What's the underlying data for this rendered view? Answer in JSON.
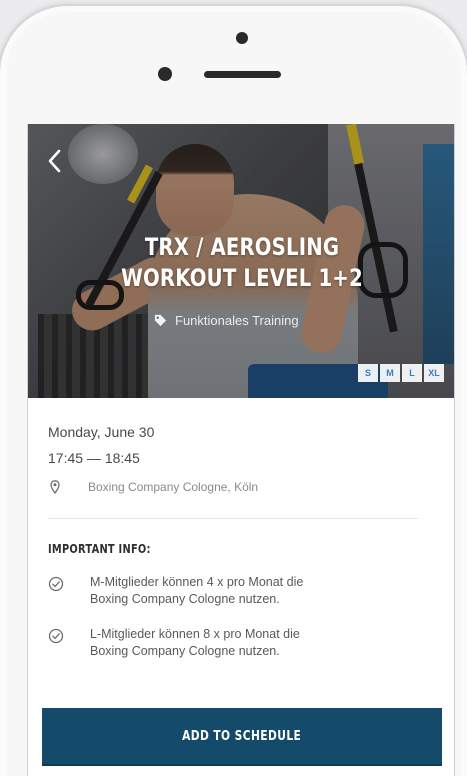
{
  "event": {
    "title_line1": "TRX / AEROSLING",
    "title_line2": "WORKOUT LEVEL 1+2",
    "category": "Funktionales Training",
    "sizes": [
      "S",
      "M",
      "L",
      "XL"
    ],
    "date": "Monday, June 30",
    "time": "17:45 — 18:45",
    "location": "Boxing Company Cologne, Köln"
  },
  "important": {
    "title": "IMPORTANT INFO:",
    "items": [
      {
        "line1": "M-Mitglieder können 4 x pro Monat die",
        "line2": "Boxing Company Cologne nutzen."
      },
      {
        "line1": "L-Mitglieder können 8 x pro Monat die",
        "line2": "Boxing Company Cologne nutzen."
      }
    ]
  },
  "actions": {
    "add_label": "ADD TO SCHEDULE"
  },
  "icons": {
    "back": "chevron-left-icon",
    "tag": "tag-icon",
    "location": "location-pin-icon",
    "check": "check-circle-icon"
  },
  "colors": {
    "cta": "#144a6a",
    "size_tag_text": "#2f88c8"
  }
}
